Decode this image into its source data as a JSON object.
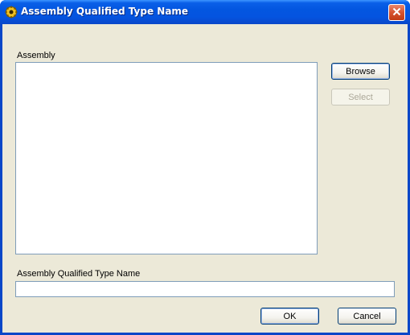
{
  "window": {
    "title": "Assembly Qualified Type Name",
    "title_icon": "gear-icon",
    "close_icon": "close-icon"
  },
  "assembly_section": {
    "label": "Assembly",
    "items": []
  },
  "buttons": {
    "browse_label": "Browse",
    "select_label": "Select",
    "select_enabled": false,
    "ok_label": "OK",
    "cancel_label": "Cancel"
  },
  "type_name_section": {
    "label": "Assembly Qualified Type Name",
    "value": ""
  },
  "colors": {
    "titlebar_blue": "#0356e0",
    "client_bg": "#ece9d8",
    "close_red": "#d6532f",
    "field_border": "#7f9db9"
  }
}
